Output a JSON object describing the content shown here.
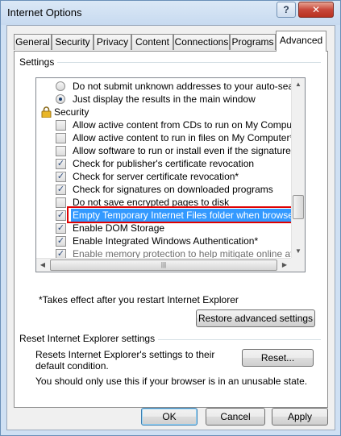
{
  "window": {
    "title": "Internet Options",
    "help_label": "?",
    "close_label": "✕"
  },
  "tabs": [
    {
      "label": "General"
    },
    {
      "label": "Security"
    },
    {
      "label": "Privacy"
    },
    {
      "label": "Content"
    },
    {
      "label": "Connections"
    },
    {
      "label": "Programs"
    },
    {
      "label": "Advanced",
      "active": true
    }
  ],
  "settings": {
    "label": "Settings",
    "rows": [
      {
        "kind": "radio",
        "checked": false,
        "text": "Do not submit unknown addresses to your auto-search pr"
      },
      {
        "kind": "radio",
        "checked": true,
        "text": "Just display the results in the main window"
      },
      {
        "kind": "category",
        "icon": "lock-icon",
        "text": "Security"
      },
      {
        "kind": "checkbox",
        "checked": false,
        "text": "Allow active content from CDs to run on My Computer*"
      },
      {
        "kind": "checkbox",
        "checked": false,
        "text": "Allow active content to run in files on My Computer*"
      },
      {
        "kind": "checkbox",
        "checked": false,
        "text": "Allow software to run or install even if the signature is inva"
      },
      {
        "kind": "checkbox",
        "checked": true,
        "text": "Check for publisher's certificate revocation"
      },
      {
        "kind": "checkbox",
        "checked": true,
        "text": "Check for server certificate revocation*"
      },
      {
        "kind": "checkbox",
        "checked": true,
        "text": "Check for signatures on downloaded programs"
      },
      {
        "kind": "checkbox",
        "checked": false,
        "text": "Do not save encrypted pages to disk"
      },
      {
        "kind": "checkbox",
        "checked": true,
        "selected": true,
        "text": "Empty Temporary Internet Files folder when browser is clo"
      },
      {
        "kind": "checkbox",
        "checked": true,
        "text": "Enable DOM Storage"
      },
      {
        "kind": "checkbox",
        "checked": true,
        "text": "Enable Integrated Windows Authentication*"
      },
      {
        "kind": "checkbox",
        "checked": true,
        "faded": true,
        "text": "Enable memory protection to help mitigate online attacks*"
      }
    ],
    "restart_note": "*Takes effect after you restart Internet Explorer",
    "restore_button": "Restore advanced settings"
  },
  "reset": {
    "label": "Reset Internet Explorer settings",
    "description": "Resets Internet Explorer's settings to their default condition.",
    "button": "Reset...",
    "warning": "You should only use this if your browser is in an unusable state."
  },
  "footer": {
    "ok": "OK",
    "cancel": "Cancel",
    "apply": "Apply"
  },
  "colors": {
    "selection": "#3399ff",
    "highlight_box": "#e00000"
  }
}
